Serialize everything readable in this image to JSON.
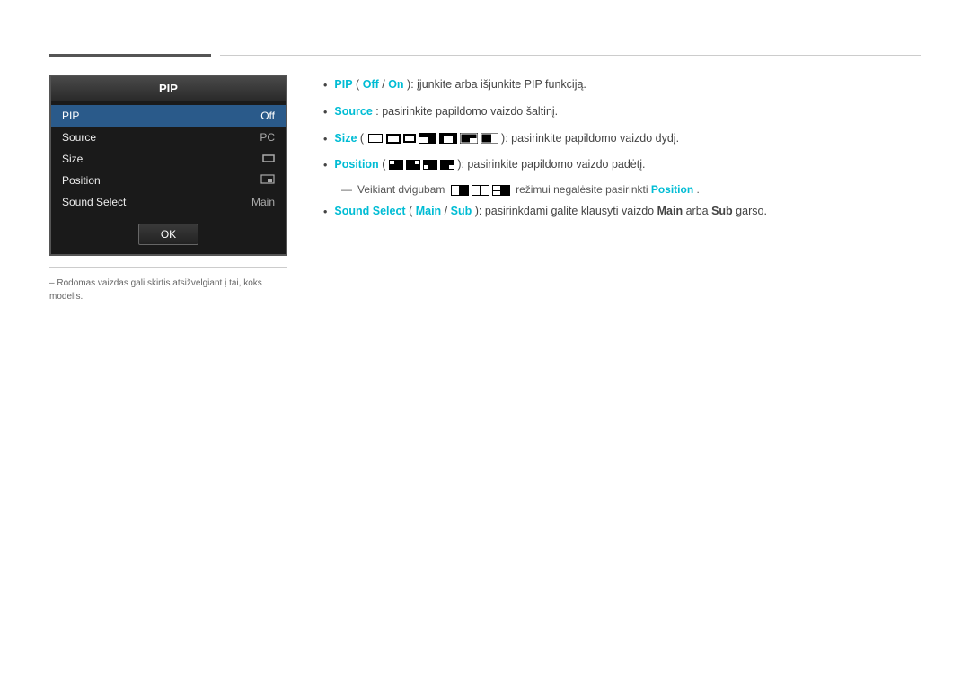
{
  "page": {
    "top_rule": true
  },
  "pip_box": {
    "title": "PIP",
    "menu_items": [
      {
        "label": "PIP",
        "value": "Off",
        "active": true
      },
      {
        "label": "Source",
        "value": "PC",
        "active": false
      },
      {
        "label": "Size",
        "value": "size_icon",
        "active": false
      },
      {
        "label": "Position",
        "value": "position_icon",
        "active": false
      },
      {
        "label": "Sound Select",
        "value": "Main",
        "active": false
      }
    ],
    "ok_button_label": "OK"
  },
  "footnote": "Rodomas vaizdas gali skirtis atsižvelgiant į tai, koks modelis.",
  "descriptions": [
    {
      "id": "pip_desc",
      "parts": [
        {
          "text": "PIP",
          "style": "cyan"
        },
        {
          "text": " (",
          "style": "normal"
        },
        {
          "text": "Off",
          "style": "cyan"
        },
        {
          "text": " / ",
          "style": "normal"
        },
        {
          "text": "On",
          "style": "cyan"
        },
        {
          "text": "): įjunkite arba išjunkite PIP funkciją.",
          "style": "normal"
        }
      ]
    },
    {
      "id": "source_desc",
      "parts": [
        {
          "text": "Source",
          "style": "cyan"
        },
        {
          "text": ": pasirinkite papildomo vaizdo šaltinį.",
          "style": "normal"
        }
      ]
    },
    {
      "id": "size_desc",
      "parts": [
        {
          "text": "Size",
          "style": "cyan"
        },
        {
          "text": ": pasirinkite papildomo vaizdo dydį.",
          "style": "normal"
        }
      ]
    },
    {
      "id": "position_desc",
      "parts": [
        {
          "text": "Position",
          "style": "cyan"
        },
        {
          "text": ": pasirinkite papildomo vaizdo padėtį.",
          "style": "normal"
        }
      ]
    },
    {
      "id": "position_note",
      "dash": true,
      "parts": [
        {
          "text": "Veikiant dvigubam",
          "style": "normal"
        },
        {
          "text": " režimui negalėsite pasirinkti ",
          "style": "normal"
        },
        {
          "text": "Position",
          "style": "cyan-bold"
        },
        {
          "text": ".",
          "style": "normal"
        }
      ]
    },
    {
      "id": "sound_select_desc",
      "parts": [
        {
          "text": "Sound Select",
          "style": "cyan"
        },
        {
          "text": " (",
          "style": "normal"
        },
        {
          "text": "Main",
          "style": "cyan"
        },
        {
          "text": " / ",
          "style": "normal"
        },
        {
          "text": "Sub",
          "style": "cyan"
        },
        {
          "text": "): pasirinkdami galite klausyti vaizdo ",
          "style": "normal"
        },
        {
          "text": "Main",
          "style": "bold"
        },
        {
          "text": " arba ",
          "style": "normal"
        },
        {
          "text": "Sub",
          "style": "bold"
        },
        {
          "text": " garso.",
          "style": "normal"
        }
      ]
    }
  ]
}
